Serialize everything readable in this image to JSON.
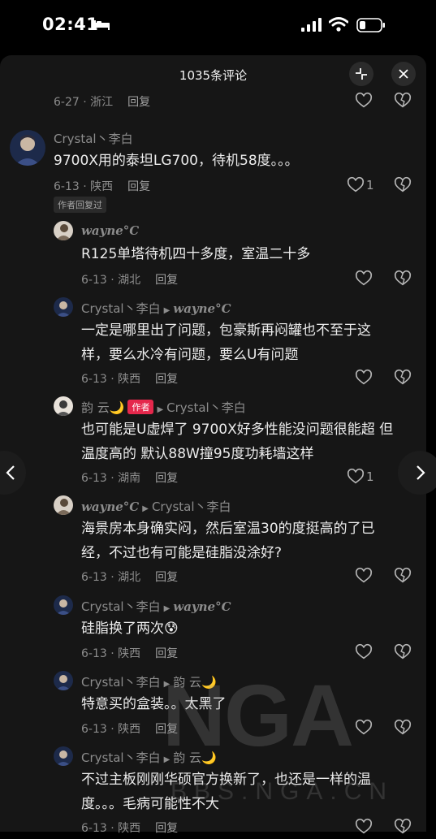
{
  "status_bar": {
    "time": "02:41"
  },
  "header": {
    "title": "1035条评论"
  },
  "top_partial": {
    "date_location": "6-27 · 浙江",
    "reply": "回复"
  },
  "comments": [
    {
      "user": "Crystal丶李白",
      "text": "9700X用的泰坦LG700，待机58度。。。",
      "date_location": "6-13 · 陕西",
      "reply": "回复",
      "likes": "1",
      "badge": "作者回复过"
    },
    {
      "user": "wayne°C",
      "text": "R125单塔待机四十多度，室温二十多",
      "date_location": "6-13 · 湖北",
      "reply": "回复"
    },
    {
      "user": "Crystal丶李白",
      "reply_to": "wayne°C",
      "text1": "一定是哪里出了问题，包豪斯再闷罐也不至于这",
      "text2": "样，要么水冷有问题，要么U有问题",
      "date_location": "6-13 · 陕西",
      "reply": "回复"
    },
    {
      "user": "韵 云🌙",
      "author_tag": "作者",
      "reply_to": "Crystal丶李白",
      "text1": "也可能是U虚焊了  9700X好多性能没问题很能超 但",
      "text2": "温度高的 默认88W撞95度功耗墙这样",
      "date_location": "6-13 · 湖南",
      "reply": "回复",
      "likes": "1"
    },
    {
      "user": "wayne°C",
      "reply_to": "Crystal丶李白",
      "text1": "海景房本身确实闷，然后室温30的度挺高的了已",
      "text2": "经，不过也有可能是硅脂没涂好?",
      "date_location": "6-13 · 湖北",
      "reply": "回复"
    },
    {
      "user": "Crystal丶李白",
      "reply_to": "wayne°C",
      "text": "硅脂换了两次😰",
      "date_location": "6-13 · 陕西",
      "reply": "回复"
    },
    {
      "user": "Crystal丶李白",
      "reply_to": "韵 云🌙",
      "text": "特意买的盒装。。太黑了",
      "date_location": "6-13 · 陕西",
      "reply": "回复"
    },
    {
      "user": "Crystal丶李白",
      "reply_to": "韵 云🌙",
      "text1": "不过主板刚刚华硕官方换新了，也还是一样的温",
      "text2": "度。。。毛病可能性不大",
      "date_location": "6-13 · 陕西",
      "reply": "回复"
    }
  ],
  "watermark": {
    "brand": "NGA",
    "url": "BBS.NGA.CN"
  }
}
